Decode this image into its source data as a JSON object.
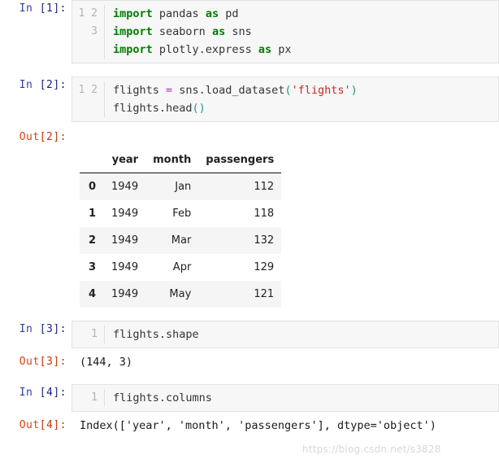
{
  "cells": [
    {
      "prompt_label": "In",
      "prompt_count": "[1]:",
      "line_numbers": [
        "1",
        "2",
        "3"
      ],
      "code_lines": [
        [
          {
            "t": "import",
            "c": "kw"
          },
          {
            "t": " pandas ",
            "c": "pl"
          },
          {
            "t": "as",
            "c": "kw"
          },
          {
            "t": " pd",
            "c": "pl"
          }
        ],
        [
          {
            "t": "import",
            "c": "kw"
          },
          {
            "t": " seaborn ",
            "c": "pl"
          },
          {
            "t": "as",
            "c": "kw"
          },
          {
            "t": " sns",
            "c": "pl"
          }
        ],
        [
          {
            "t": "import",
            "c": "kw"
          },
          {
            "t": " plotly.express ",
            "c": "pl"
          },
          {
            "t": "as",
            "c": "kw"
          },
          {
            "t": " px",
            "c": "pl"
          }
        ]
      ]
    },
    {
      "prompt_label": "In",
      "prompt_count": "[2]:",
      "line_numbers": [
        "1",
        "2"
      ],
      "code_lines": [
        [
          {
            "t": "flights ",
            "c": "pl"
          },
          {
            "t": "=",
            "c": "op"
          },
          {
            "t": " sns.load_dataset",
            "c": "pl"
          },
          {
            "t": "(",
            "c": "par"
          },
          {
            "t": "'flights'",
            "c": "str"
          },
          {
            "t": ")",
            "c": "par"
          }
        ],
        [
          {
            "t": "flights.head",
            "c": "pl"
          },
          {
            "t": "()",
            "c": "par"
          }
        ]
      ]
    },
    {
      "prompt_label": "In",
      "prompt_count": "[3]:",
      "line_numbers": [
        "1"
      ],
      "code_lines": [
        [
          {
            "t": "flights.shape",
            "c": "pl"
          }
        ]
      ]
    },
    {
      "prompt_label": "In",
      "prompt_count": "[4]:",
      "line_numbers": [
        "1"
      ],
      "code_lines": [
        [
          {
            "t": "flights.columns",
            "c": "pl"
          }
        ]
      ]
    }
  ],
  "outputs": {
    "out2": {
      "prompt_label": "Out",
      "prompt_count": "[2]:"
    },
    "out3": {
      "prompt_label": "Out",
      "prompt_count": "[3]:",
      "value": "(144, 3)"
    },
    "out4": {
      "prompt_label": "Out",
      "prompt_count": "[4]:",
      "value": "Index(['year', 'month', 'passengers'], dtype='object')"
    }
  },
  "dataframe": {
    "index_header": "",
    "columns": [
      "year",
      "month",
      "passengers"
    ],
    "index": [
      "0",
      "1",
      "2",
      "3",
      "4"
    ],
    "rows": [
      [
        "1949",
        "Jan",
        "112"
      ],
      [
        "1949",
        "Feb",
        "118"
      ],
      [
        "1949",
        "Mar",
        "132"
      ],
      [
        "1949",
        "Apr",
        "129"
      ],
      [
        "1949",
        "May",
        "121"
      ]
    ]
  },
  "watermark": {
    "text": "https://blog.csdn.net/s3828"
  },
  "colors": {
    "prompt_in": "#303F9F",
    "prompt_out": "#D84315",
    "keyword": "#007d00",
    "string": "#c62828",
    "operator": "#a626a4",
    "paren": "#1a9988",
    "cell_bg": "#f7f7f7",
    "cell_border": "#e3e3e3",
    "row_stripe": "#f5f5f5"
  }
}
